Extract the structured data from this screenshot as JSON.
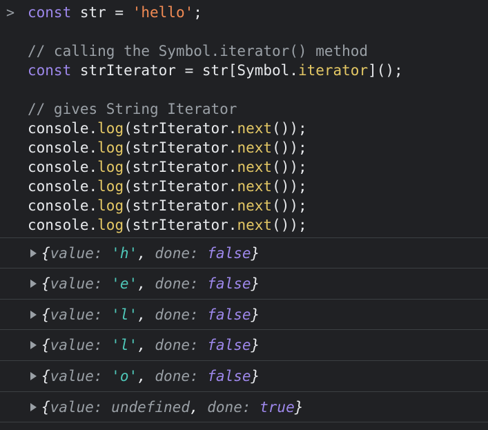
{
  "input": {
    "prompt": ">",
    "line1": {
      "kw": "const",
      "rest": " str = ",
      "str": "'hello'",
      "end": ";"
    },
    "line2": {
      "comment": "// calling the Symbol.iterator() method"
    },
    "line3": {
      "kw": "const",
      "a": " strIterator = str[Symbol.",
      "fn": "iterator",
      "end": "]();"
    },
    "line4": {
      "comment": "// gives String Iterator"
    },
    "log_lines": [
      {
        "obj": "console.",
        "log": "log",
        "mid": "(strIterator.",
        "next": "next",
        "end": "());"
      },
      {
        "obj": "console.",
        "log": "log",
        "mid": "(strIterator.",
        "next": "next",
        "end": "());"
      },
      {
        "obj": "console.",
        "log": "log",
        "mid": "(strIterator.",
        "next": "next",
        "end": "());"
      },
      {
        "obj": "console.",
        "log": "log",
        "mid": "(strIterator.",
        "next": "next",
        "end": "());"
      },
      {
        "obj": "console.",
        "log": "log",
        "mid": "(strIterator.",
        "next": "next",
        "end": "());"
      },
      {
        "obj": "console.",
        "log": "log",
        "mid": "(strIterator.",
        "next": "next",
        "end": "());"
      }
    ]
  },
  "output": [
    {
      "open": "{",
      "k1": "value",
      "v1": "'h'",
      "sep": ", ",
      "k2": "done",
      "v2": "false",
      "close": "}"
    },
    {
      "open": "{",
      "k1": "value",
      "v1": "'e'",
      "sep": ", ",
      "k2": "done",
      "v2": "false",
      "close": "}"
    },
    {
      "open": "{",
      "k1": "value",
      "v1": "'l'",
      "sep": ", ",
      "k2": "done",
      "v2": "false",
      "close": "}"
    },
    {
      "open": "{",
      "k1": "value",
      "v1": "'l'",
      "sep": ", ",
      "k2": "done",
      "v2": "false",
      "close": "}"
    },
    {
      "open": "{",
      "k1": "value",
      "v1": "'o'",
      "sep": ", ",
      "k2": "done",
      "v2": "false",
      "close": "}"
    },
    {
      "open": "{",
      "k1": "value",
      "v1": "undefined",
      "sep": ", ",
      "k2": "done",
      "v2": "true",
      "close": "}"
    }
  ]
}
